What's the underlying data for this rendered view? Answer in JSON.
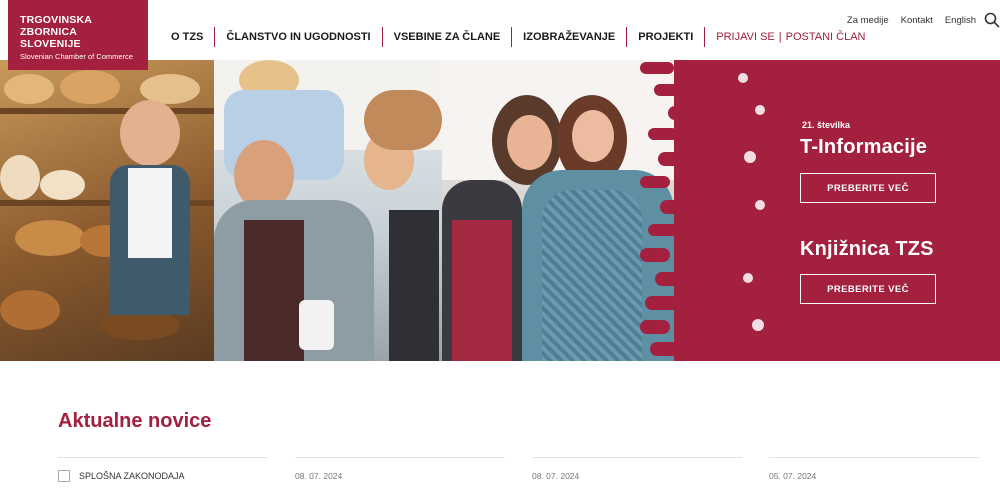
{
  "brand": {
    "line1": "TRGOVINSKA",
    "line2": "ZBORNICA SLOVENIJE",
    "subtitle": "Slovenian Chamber of Commerce",
    "color": "#a3203f"
  },
  "nav": {
    "items": [
      "O TZS",
      "ČLANSTVO IN UGODNOSTI",
      "VSEBINE ZA ČLANE",
      "IZOBRAŽEVANJE",
      "PROJEKTI"
    ],
    "login": "PRIJAVI SE",
    "join": "POSTANI ČLAN",
    "separator": "|"
  },
  "top_links": [
    "Za medije",
    "Kontakt",
    "English"
  ],
  "icons": {
    "search": "search-icon"
  },
  "hero": {
    "issue": "21. številka",
    "title1": "T-Informacije",
    "button1": "PREBERITE VEČ",
    "title2": "Knjižnica TZS",
    "button2": "PREBERITE VEČ"
  },
  "news": {
    "title": "Aktualne novice",
    "filter_label": "SPLOŠNA ZAKONODAJA",
    "dates": [
      "08. 07. 2024",
      "08. 07. 2024",
      "05. 07. 2024"
    ]
  }
}
